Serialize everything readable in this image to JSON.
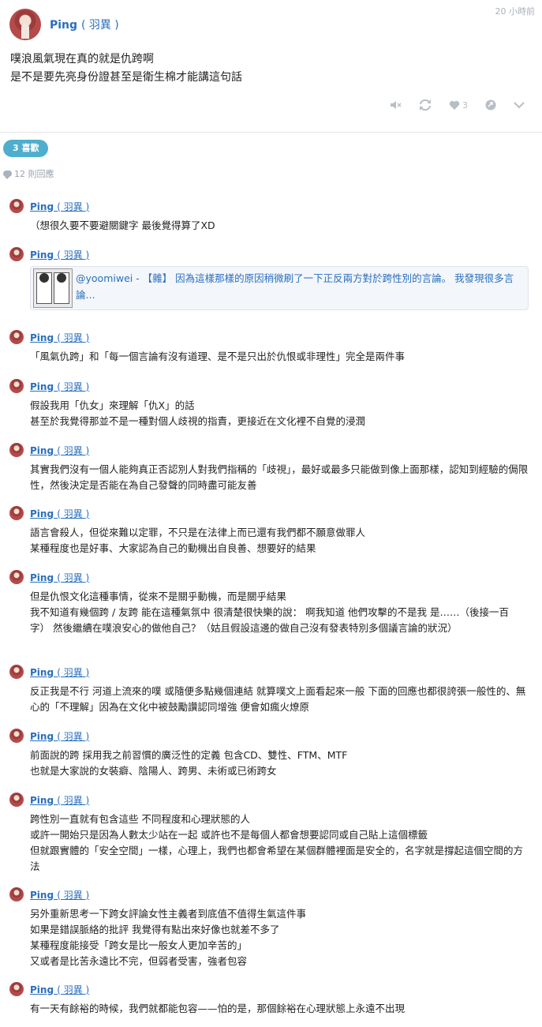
{
  "post": {
    "author_name": "Ping",
    "author_handle": "( 羽異 )",
    "time": "20 小時前",
    "lines": [
      "噗浪風氣現在真的就是仇跨啊",
      "是不是要先亮身份證甚至是衛生棉才能講這句話"
    ],
    "like_count": "3"
  },
  "stats": {
    "likes_badge": "3 喜歡",
    "reply_count": "12 則回應"
  },
  "replies": [
    {
      "name": "Ping",
      "handle": "( 羽異 )",
      "lines": [
        "（想很久要不要避關鍵字 最後覺得算了XD"
      ]
    },
    {
      "name": "Ping",
      "handle": "( 羽異 )",
      "link_text": "@yoomiwei - 【雜】 因為這樣那樣的原因稍微刷了一下正反兩方對於跨性別的言論。 我發現很多言論..."
    },
    {
      "name": "Ping",
      "handle": "( 羽異 )",
      "lines": [
        "「風氣仇跨」和「每一個言論有沒有道理、是不是只出於仇恨或非理性」完全是兩件事"
      ]
    },
    {
      "name": "Ping",
      "handle": "( 羽異 )",
      "lines": [
        "假設我用「仇女」來理解「仇X」的話",
        "甚至於我覺得那並不是一種對個人歧視的指責，更接近在文化裡不自覺的浸潤"
      ]
    },
    {
      "name": "Ping",
      "handle": "( 羽異 )",
      "lines": [
        "其實我們沒有一個人能夠真正否認別人對我們指稱的「歧視」，最好或最多只能做到像上面那樣，認知到經驗的侷限性，然後決定是否能在為自己發聲的同時盡可能友善"
      ]
    },
    {
      "name": "Ping",
      "handle": "( 羽異 )",
      "lines": [
        "語言會殺人，但從來難以定罪，不只是在法律上而已還有我們都不願意做罪人",
        "某種程度也是好事、大家認為自己的動機出自良善、想要好的結果"
      ]
    },
    {
      "name": "Ping",
      "handle": "( 羽異 )",
      "lines": [
        "但是仇恨文化這種事情，從來不是關乎動機，而是關乎結果",
        "我不知道有幾個跨 / 友跨 能在這種氣氛中 很清楚很快樂的說： 啊我知道 他們攻擊的不是我 是……（後接一百字） 然後繼續在噗浪安心的做他自己？（姑且假設這邊的做自己沒有發表特別多個議言論的狀況）"
      ]
    },
    {
      "name": "Ping",
      "handle": "( 羽異 )",
      "lines": [
        "反正我是不行 河道上流來的噗 或隨便多點幾個連結 就算噗文上面看起來一般 下面的回應也都很誇張一般性的、無心的「不理解」因為在文化中被鼓勵讚認同增強 便會如瘋火燎原"
      ]
    },
    {
      "name": "Ping",
      "handle": "( 羽異 )",
      "lines": [
        "前面說的跨 採用我之前習慣的廣泛性的定義 包含CD、雙性、FTM、MTF",
        "也就是大家說的女裝癖、陰陽人、跨男、未術或已術跨女"
      ]
    },
    {
      "name": "Ping",
      "handle": "( 羽異 )",
      "lines": [
        "跨性別一直就有包含這些 不同程度和心理狀態的人",
        "或許一開始只是因為人數太少站在一起 或許也不是每個人都會想要認同或自己貼上這個標籤",
        "但就跟實體的「安全空間」一樣，心理上，我們也都會希望在某個群體裡面是安全的，名字就是撐起這個空間的方法"
      ]
    },
    {
      "name": "Ping",
      "handle": "( 羽異 )",
      "lines": [
        "另外重新思考一下跨女評論女性主義者到底值不值得生氣這件事",
        "如果是錯誤脈絡的批評 我覺得有點出來好像也就差不多了",
        "某種程度能接受「跨女是比一般女人更加辛苦的」",
        "又或者是比苦永遠比不完，但弱者受害，強者包容"
      ]
    },
    {
      "name": "Ping",
      "handle": "( 羽異 )",
      "lines": [
        "有一天有餘裕的時候，我們就都能包容——怕的是，那個餘裕在心理狀態上永遠不出現"
      ]
    }
  ]
}
